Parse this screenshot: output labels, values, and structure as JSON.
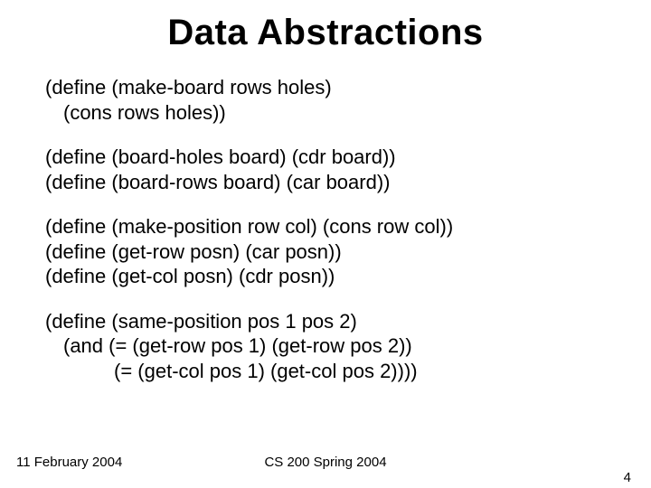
{
  "title": "Data Abstractions",
  "block1": {
    "line1": "(define (make-board rows holes)",
    "line2": "(cons rows holes))"
  },
  "block2": {
    "line1": "(define (board-holes board) (cdr board))",
    "line2": "(define (board-rows board) (car board))"
  },
  "block3": {
    "line1": "(define (make-position row col) (cons row col))",
    "line2": "(define (get-row posn) (car posn))",
    "line3": "(define (get-col posn) (cdr posn))"
  },
  "block4": {
    "line1": "(define (same-position pos 1 pos 2)",
    "line2": "(and (= (get-row pos 1) (get-row pos 2))",
    "line3": "(= (get-col pos 1) (get-col pos 2))))"
  },
  "footer": {
    "date": "11 February 2004",
    "course": "CS 200 Spring 2004",
    "pagenum": "4"
  }
}
